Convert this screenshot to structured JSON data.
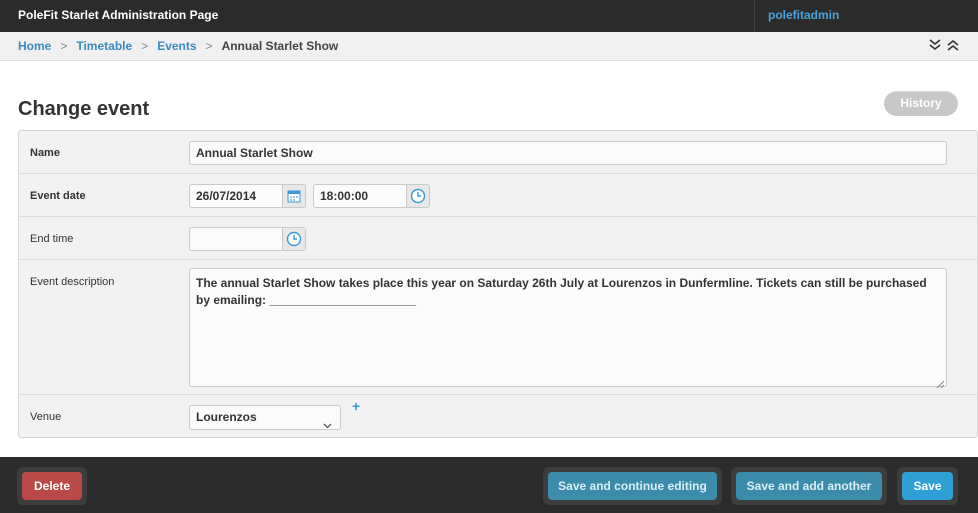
{
  "header": {
    "site_title": "PoleFit Starlet Administration Page",
    "user_name": "polefitadmin"
  },
  "breadcrumbs": {
    "items": [
      "Home",
      "Timetable",
      "Events"
    ],
    "current": "Annual Starlet Show",
    "separator": ">"
  },
  "page": {
    "title": "Change event",
    "history_label": "History"
  },
  "form": {
    "name": {
      "label": "Name",
      "value": "Annual Starlet Show"
    },
    "event_date": {
      "label": "Event date",
      "date": "26/07/2014",
      "time": "18:00:00"
    },
    "end_time": {
      "label": "End time",
      "value": ""
    },
    "description": {
      "label": "Event description",
      "value": "The annual Starlet Show takes place this year on Saturday 26th July at Lourenzos in Dunfermline. Tickets can still be purchased by emailing: ______________________"
    },
    "venue": {
      "label": "Venue",
      "selected": "Lourenzos",
      "add_label": "+"
    }
  },
  "footer": {
    "delete_label": "Delete",
    "save_continue_label": "Save and continue editing",
    "save_add_label": "Save and add another",
    "save_label": "Save"
  },
  "colors": {
    "topbar": "#2b2b2b",
    "link": "#3a8bbf",
    "delete": "#b94a48",
    "secondary": "#3b8bab",
    "primary": "#2f9fd6"
  },
  "icons": {
    "calendar": "calendar-icon",
    "clock": "clock-icon",
    "expand": "expand-all-icon",
    "collapse": "collapse-all-icon"
  }
}
